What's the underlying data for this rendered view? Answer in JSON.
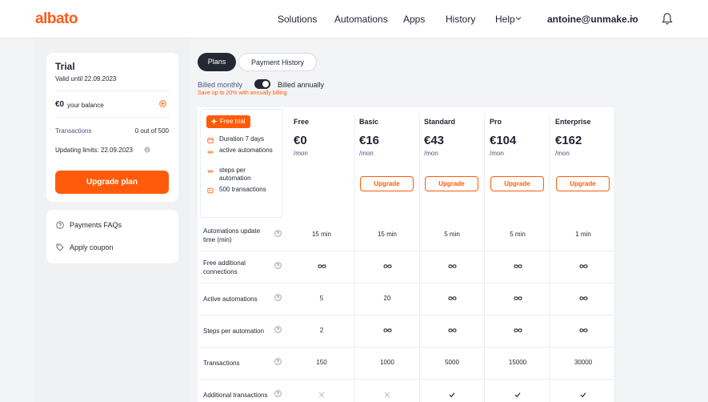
{
  "header": {
    "logo": "albato",
    "nav": [
      "Solutions",
      "Automations",
      "Apps",
      "History",
      "Help"
    ],
    "user": "antoine@unmake.io"
  },
  "trial": {
    "title": "Trial",
    "valid_until": "Valid until 22.09.2023",
    "balance_amount": "€0",
    "balance_label": "your balance",
    "transactions_label": "Transactions",
    "transactions_value": "0 out of 500",
    "updating_limits": "Updating limits: 22.09.2023",
    "upgrade_label": "Upgrade plan"
  },
  "help": {
    "faq": "Payments FAQs",
    "coupon": "Apply coupon"
  },
  "tabs": {
    "plans": "Plans",
    "history": "Payment History"
  },
  "billing": {
    "monthly": "Billed monthly",
    "annually": "Billed annually",
    "annual_selected": true,
    "save_note": "Save up to 20% with annually billing"
  },
  "free_trial": {
    "badge": "Free trial",
    "features": [
      "Duration 7 days",
      "active automations",
      "steps per automation",
      "500 transactions"
    ]
  },
  "plans": [
    {
      "name": "Free",
      "price": "€0",
      "per": "/mon",
      "upgrade": ""
    },
    {
      "name": "Basic",
      "price": "€16",
      "per": "/mon",
      "upgrade": "Upgrade"
    },
    {
      "name": "Standard",
      "price": "€43",
      "per": "/mon",
      "upgrade": "Upgrade"
    },
    {
      "name": "Pro",
      "price": "€104",
      "per": "/mon",
      "upgrade": "Upgrade"
    },
    {
      "name": "Enterprise",
      "price": "€162",
      "per": "/mon",
      "upgrade": "Upgrade"
    }
  ],
  "rows": [
    {
      "label": "Automations update time (min)",
      "values": [
        "15 min",
        "15 min",
        "5 min",
        "5 min",
        "1 min"
      ]
    },
    {
      "label": "Free additional connections",
      "values": [
        "∞",
        "∞",
        "∞",
        "∞",
        "∞"
      ]
    },
    {
      "label": "Active automations",
      "values": [
        "5",
        "20",
        "∞",
        "∞",
        "∞"
      ]
    },
    {
      "label": "Steps per automation",
      "values": [
        "2",
        "∞",
        "∞",
        "∞",
        "∞"
      ]
    },
    {
      "label": "Transactions",
      "values": [
        "150",
        "1000",
        "5000",
        "15000",
        "30000"
      ]
    },
    {
      "label": "Additional transactions",
      "values": [
        "✕",
        "✕",
        "✓",
        "✓",
        "✓"
      ]
    }
  ]
}
